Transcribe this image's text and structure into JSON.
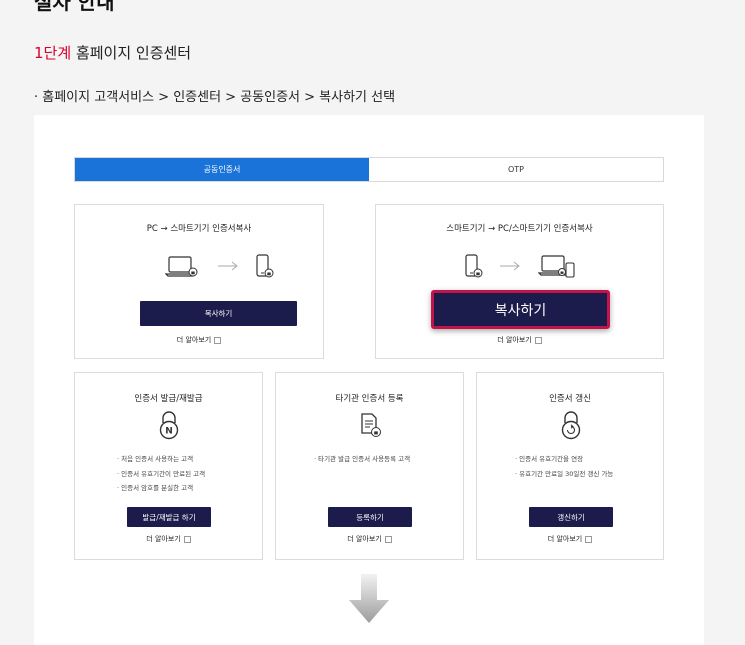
{
  "heading": "절차 안내",
  "step": {
    "number": "1단계",
    "title": "홈페이지 인증센터"
  },
  "path": "· 홈페이지 고객서비스 > 인증센터 > 공동인증서 > 복사하기 선택",
  "tabs": [
    {
      "label": "공동인증서",
      "active": true
    },
    {
      "label": "OTP",
      "active": false
    }
  ],
  "cards": {
    "pc_to_phone": {
      "title": "PC → 스마트기기 인증서복사",
      "button": "복사하기",
      "more": "더 알아보기"
    },
    "phone_to_pc": {
      "title": "스마트기기 → PC/스마트기기 인증서복사",
      "button": "복사하기",
      "more": "더 알아보기"
    },
    "issue": {
      "title": "인증서 발급/재발급",
      "bullets": [
        "· 처음 인증서 사용하는 고객",
        "· 인증서 유효기간이 만료된 고객",
        "· 인증서 암호를 분실한 고객"
      ],
      "button": "발급/재발급 하기",
      "more": "더 알아보기"
    },
    "register": {
      "title": "타기관 인증서 등록",
      "bullets": [
        "· 타기관 발급 인증서 사용등록 고객"
      ],
      "button": "등록하기",
      "more": "더 알아보기"
    },
    "renew": {
      "title": "인증서 갱신",
      "bullets": [
        "· 인증서 유효기간을 연장",
        "· 유효기간 만료일 30일전 갱신 가능"
      ],
      "button": "갱신하기",
      "more": "더 알아보기"
    }
  },
  "colors": {
    "accent": "#1a73d9",
    "button": "#1c1c4c",
    "highlight": "#c0144a",
    "step_number": "#d8002c"
  }
}
